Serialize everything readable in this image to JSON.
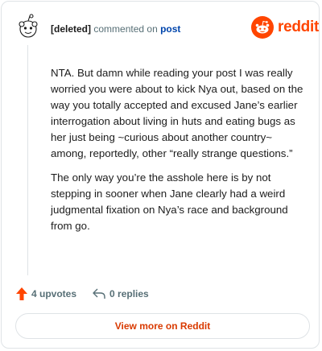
{
  "comment": {
    "author": "[deleted]",
    "action_text": "commented on",
    "target_link": "post",
    "paragraphs": [
      "NTA. But damn while reading your post I was really worried you were about to kick Nya out, based on the way you totally accepted and excused Jane’s earlier interrogation about living in huts and eating bugs as her just being ~curious about another country~ among, reportedly, other “really strange questions.”",
      "The only way you’re the asshole here is by not stepping in sooner when Jane clearly had a weird judgmental fixation on Nya’s race and background from go."
    ]
  },
  "brand": {
    "wordmark": "reddit",
    "color": "#ff4500"
  },
  "actions": {
    "upvotes_label": "4 upvotes",
    "replies_label": "0 replies"
  },
  "footer": {
    "view_more_label": "View more on Reddit"
  },
  "icons": {
    "avatar": "deleted-user-snoo-icon",
    "logo": "reddit-snoo-icon",
    "upvote": "upvote-arrow-icon",
    "reply": "reply-arrow-icon"
  },
  "colors": {
    "upvote": "#ff4500",
    "link": "#0045ac",
    "view_more": "#d93a00"
  }
}
